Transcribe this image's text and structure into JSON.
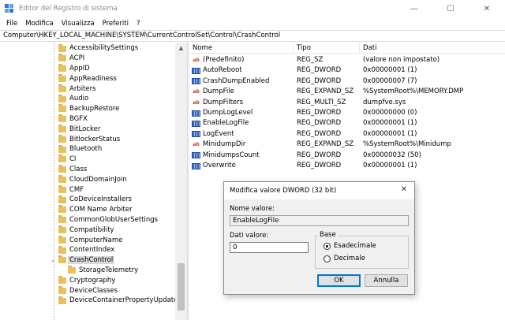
{
  "window": {
    "title": "Editor del Registro di sistema",
    "minimize": "—",
    "maximize": "☐",
    "close": "✕"
  },
  "menu": [
    "File",
    "Modifica",
    "Visualizza",
    "Preferiti",
    "?"
  ],
  "address": "Computer\\HKEY_LOCAL_MACHINE\\SYSTEM\\CurrentControlSet\\Control\\CrashControl",
  "tree": {
    "items": [
      {
        "label": "AccessibilitySettings",
        "expander": ""
      },
      {
        "label": "ACPI",
        "expander": ""
      },
      {
        "label": "AppID",
        "expander": ""
      },
      {
        "label": "AppReadiness",
        "expander": ""
      },
      {
        "label": "Arbiters",
        "expander": ""
      },
      {
        "label": "Audio",
        "expander": ""
      },
      {
        "label": "BackupRestore",
        "expander": ""
      },
      {
        "label": "BGFX",
        "expander": ""
      },
      {
        "label": "BitLocker",
        "expander": ""
      },
      {
        "label": "BitlockerStatus",
        "expander": ""
      },
      {
        "label": "Bluetooth",
        "expander": ""
      },
      {
        "label": "CI",
        "expander": ""
      },
      {
        "label": "Class",
        "expander": ""
      },
      {
        "label": "CloudDomainJoin",
        "expander": ""
      },
      {
        "label": "CMF",
        "expander": ""
      },
      {
        "label": "CoDeviceInstallers",
        "expander": ""
      },
      {
        "label": "COM Name Arbiter",
        "expander": ""
      },
      {
        "label": "CommonGlobUserSettings",
        "expander": ""
      },
      {
        "label": "Compatibility",
        "expander": ""
      },
      {
        "label": "ComputerName",
        "expander": ""
      },
      {
        "label": "ContentIndex",
        "expander": ""
      },
      {
        "label": "CrashControl",
        "expander": "⌄",
        "selected": true
      },
      {
        "label": "StorageTelemetry",
        "expander": "",
        "child": true
      },
      {
        "label": "Cryptography",
        "expander": ""
      },
      {
        "label": "DeviceClasses",
        "expander": ""
      },
      {
        "label": "DeviceContainerPropertyUpdateEvents",
        "expander": ""
      }
    ]
  },
  "list": {
    "headers": {
      "name": "Nome",
      "type": "Tipo",
      "data": "Dati"
    },
    "rows": [
      {
        "icon": "ab",
        "kind": "sz",
        "name": "(Predefinito)",
        "type": "REG_SZ",
        "data": "(valore non impostato)"
      },
      {
        "icon": "",
        "kind": "bin",
        "name": "AutoReboot",
        "type": "REG_DWORD",
        "data": "0x00000001 (1)"
      },
      {
        "icon": "",
        "kind": "bin",
        "name": "CrashDumpEnabled",
        "type": "REG_DWORD",
        "data": "0x00000007 (7)"
      },
      {
        "icon": "ab",
        "kind": "sz",
        "name": "DumpFile",
        "type": "REG_EXPAND_SZ",
        "data": "%SystemRoot%\\MEMORY.DMP"
      },
      {
        "icon": "ab",
        "kind": "sz",
        "name": "DumpFilters",
        "type": "REG_MULTI_SZ",
        "data": "dumpfve.sys"
      },
      {
        "icon": "",
        "kind": "bin",
        "name": "DumpLogLevel",
        "type": "REG_DWORD",
        "data": "0x00000000 (0)"
      },
      {
        "icon": "",
        "kind": "bin",
        "name": "EnableLogFile",
        "type": "REG_DWORD",
        "data": "0x00000001 (1)"
      },
      {
        "icon": "",
        "kind": "bin",
        "name": "LogEvent",
        "type": "REG_DWORD",
        "data": "0x00000001 (1)"
      },
      {
        "icon": "ab",
        "kind": "sz",
        "name": "MinidumpDir",
        "type": "REG_EXPAND_SZ",
        "data": "%SystemRoot%\\Minidump"
      },
      {
        "icon": "",
        "kind": "bin",
        "name": "MinidumpsCount",
        "type": "REG_DWORD",
        "data": "0x00000032 (50)"
      },
      {
        "icon": "",
        "kind": "bin",
        "name": "Overwrite",
        "type": "REG_DWORD",
        "data": "0x00000001 (1)"
      }
    ]
  },
  "dialog": {
    "title": "Modifica valore DWORD (32 bit)",
    "close": "✕",
    "name_label": "Nome valore:",
    "name_value": "EnableLogFile",
    "data_label": "Dati valore:",
    "data_value": "0",
    "base_label": "Base",
    "radio_hex": "Esadecimale",
    "radio_dec": "Decimale",
    "ok": "OK",
    "cancel": "Annulla"
  },
  "colors": {
    "folder": "#e8c15d",
    "selection": "#d9d9d9",
    "accent": "#0078d7"
  }
}
